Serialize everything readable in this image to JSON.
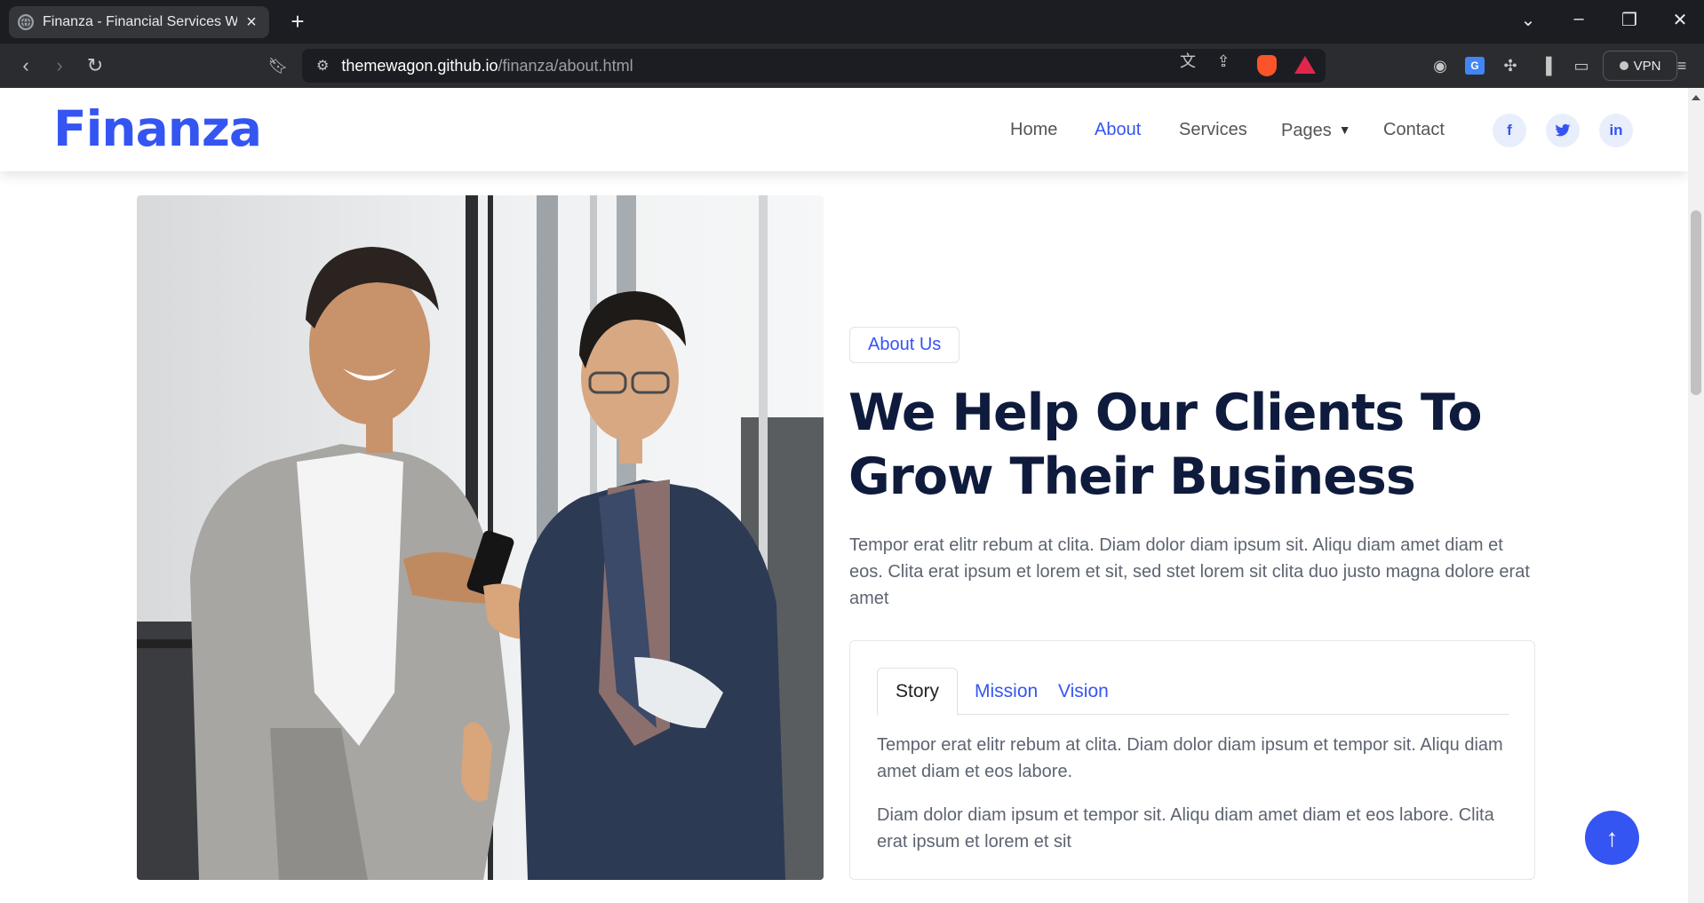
{
  "browser": {
    "tab_title": "Finanza - Financial Services Web",
    "new_tab": "+",
    "url_host": "themewagon.github.io",
    "url_path": "/finanza/about.html",
    "vpn_label": "VPN",
    "icons": [
      "back-arrow",
      "forward-arrow",
      "reload",
      "bookmark",
      "site-info",
      "translate",
      "share",
      "brave-shields",
      "brave-rewards",
      "reader",
      "google-translate",
      "extensions",
      "sidebar",
      "wallet",
      "menu"
    ]
  },
  "site": {
    "brand": "Finanza",
    "nav": [
      "Home",
      "About",
      "Services",
      "Pages",
      "Contact"
    ],
    "active_nav": "About",
    "social": [
      "f",
      "t",
      "in"
    ],
    "brand_color": "#3555f2",
    "heading_color": "#0f1b3d"
  },
  "about": {
    "badge": "About Us",
    "heading": "We Help Our Clients To Grow Their Business",
    "lead": "Tempor erat elitr rebum at clita. Diam dolor diam ipsum sit. Aliqu diam amet diam et eos. Clita erat ipsum et lorem et sit, sed stet lorem sit clita duo justo magna dolore erat amet",
    "tabs": [
      "Story",
      "Mission",
      "Vision"
    ],
    "active_tab": "Story",
    "tab_paragraph_1": "Tempor erat elitr rebum at clita. Diam dolor diam ipsum et tempor sit. Aliqu diam amet diam et eos labore.",
    "tab_paragraph_2": "Diam dolor diam ipsum et tempor sit. Aliqu diam amet diam et eos labore. Clita erat ipsum et lorem et sit"
  }
}
